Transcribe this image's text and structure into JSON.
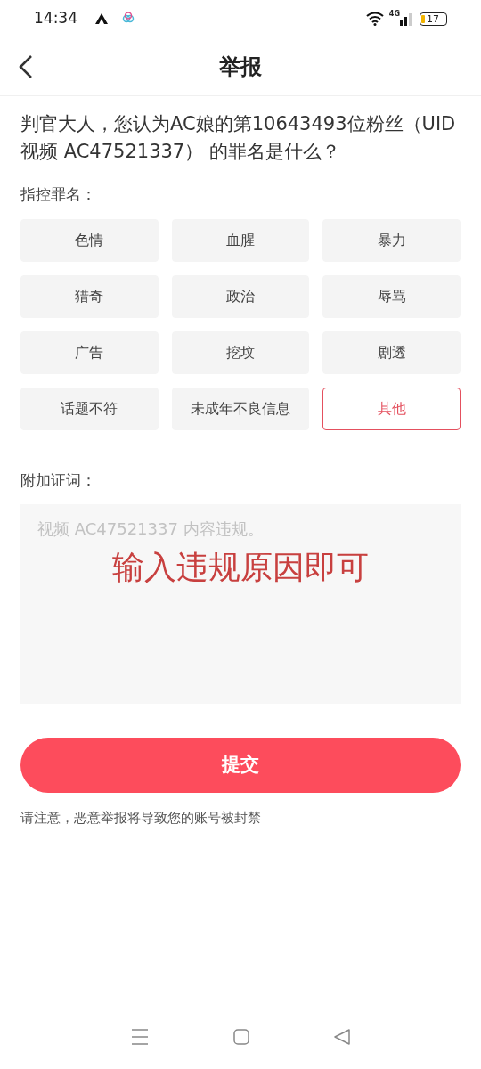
{
  "status_bar": {
    "time": "14:34",
    "network": "4G",
    "battery": "17"
  },
  "header": {
    "title": "举报"
  },
  "question": "判官大人，您认为AC娘的第10643493位粉丝（UID 视频 AC47521337） 的罪名是什么？",
  "charges_label": "指控罪名：",
  "charges": [
    {
      "label": "色情",
      "selected": false
    },
    {
      "label": "血腥",
      "selected": false
    },
    {
      "label": "暴力",
      "selected": false
    },
    {
      "label": "猎奇",
      "selected": false
    },
    {
      "label": "政治",
      "selected": false
    },
    {
      "label": "辱骂",
      "selected": false
    },
    {
      "label": "广告",
      "selected": false
    },
    {
      "label": "挖坟",
      "selected": false
    },
    {
      "label": "剧透",
      "selected": false
    },
    {
      "label": "话题不符",
      "selected": false
    },
    {
      "label": "未成年不良信息",
      "selected": false
    },
    {
      "label": "其他",
      "selected": true
    }
  ],
  "testimony_label": "附加证词：",
  "testimony": {
    "placeholder": "视频 AC47521337 内容违规。"
  },
  "annotation": "输入违规原因即可",
  "submit": "提交",
  "notice": "请注意，恶意举报将导致您的账号被封禁"
}
